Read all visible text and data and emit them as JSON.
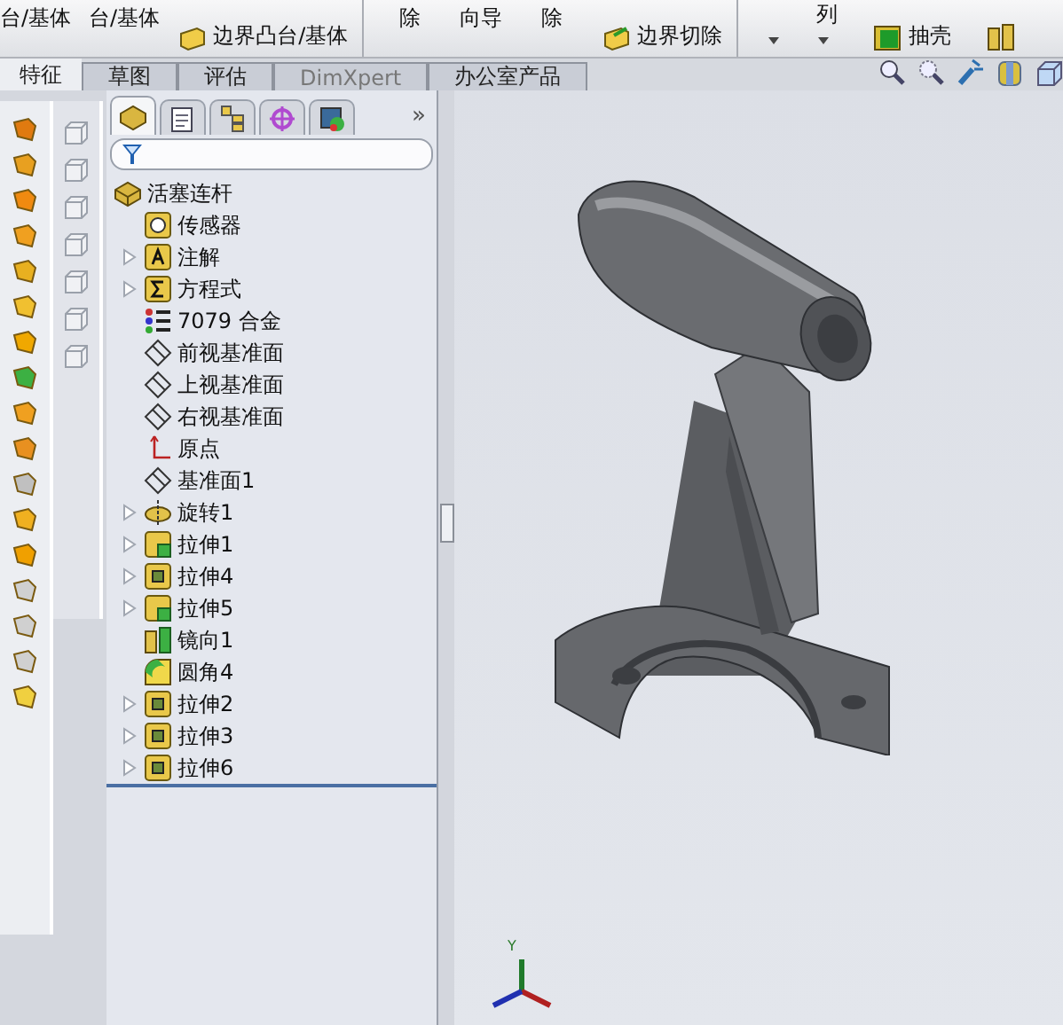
{
  "ribbon_groups": [
    {
      "columns": [
        [
          {
            "kind": "plain",
            "label": "台/基体"
          }
        ],
        [
          {
            "kind": "plain",
            "label": "台/基体"
          }
        ],
        [
          {
            "kind": "boss",
            "label": "边界凸台/基体"
          }
        ]
      ]
    },
    {
      "columns": [
        [
          {
            "kind": "plain",
            "label": "除"
          }
        ],
        [
          {
            "kind": "plain",
            "label": "向导"
          }
        ],
        [
          {
            "kind": "plain",
            "label": "除"
          }
        ],
        [
          {
            "kind": "cut",
            "label": "边界切除"
          }
        ]
      ]
    },
    {
      "columns": [
        [
          {
            "kind": "caret"
          }
        ],
        [
          {
            "kind": "partial",
            "label": "列"
          },
          {
            "kind": "caret"
          }
        ],
        [
          {
            "kind": "shell",
            "label": "抽壳"
          }
        ],
        [
          {
            "kind": "mirror"
          }
        ]
      ]
    }
  ],
  "tabs": [
    {
      "label": "特征",
      "selected": true,
      "disabled": false
    },
    {
      "label": "草图",
      "selected": false,
      "disabled": false
    },
    {
      "label": "评估",
      "selected": false,
      "disabled": false
    },
    {
      "label": "DimXpert",
      "selected": false,
      "disabled": true
    },
    {
      "label": "办公室产品",
      "selected": false,
      "disabled": false
    }
  ],
  "panel_tabs": [
    {
      "selected": true
    },
    {
      "selected": false
    },
    {
      "selected": false
    },
    {
      "selected": false
    },
    {
      "selected": false
    }
  ],
  "panel_more": "»",
  "tree": {
    "label": "活塞连杆",
    "kind": "part",
    "children": [
      {
        "label": "传感器",
        "kind": "sensor",
        "expandable": false
      },
      {
        "label": "注解",
        "kind": "annotation",
        "expandable": true
      },
      {
        "label": "方程式",
        "kind": "equation",
        "expandable": true
      },
      {
        "label": "7079 合金",
        "kind": "material",
        "expandable": false
      },
      {
        "label": "前视基准面",
        "kind": "plane",
        "expandable": false
      },
      {
        "label": "上视基准面",
        "kind": "plane",
        "expandable": false
      },
      {
        "label": "右视基准面",
        "kind": "plane",
        "expandable": false
      },
      {
        "label": "原点",
        "kind": "origin",
        "expandable": false
      },
      {
        "label": "基准面1",
        "kind": "plane",
        "expandable": false
      },
      {
        "label": "旋转1",
        "kind": "revolve",
        "expandable": true
      },
      {
        "label": "拉伸1",
        "kind": "extrude-sketch",
        "expandable": true
      },
      {
        "label": "拉伸4",
        "kind": "extrude",
        "expandable": true
      },
      {
        "label": "拉伸5",
        "kind": "extrude-sketch",
        "expandable": true
      },
      {
        "label": "镜向1",
        "kind": "mirror",
        "expandable": false
      },
      {
        "label": "圆角4",
        "kind": "fillet",
        "expandable": false
      },
      {
        "label": "拉伸2",
        "kind": "extrude",
        "expandable": true
      },
      {
        "label": "拉伸3",
        "kind": "extrude",
        "expandable": true
      },
      {
        "label": "拉伸6",
        "kind": "extrude",
        "expandable": true
      }
    ]
  },
  "triad": {
    "axis_label": "Y"
  }
}
